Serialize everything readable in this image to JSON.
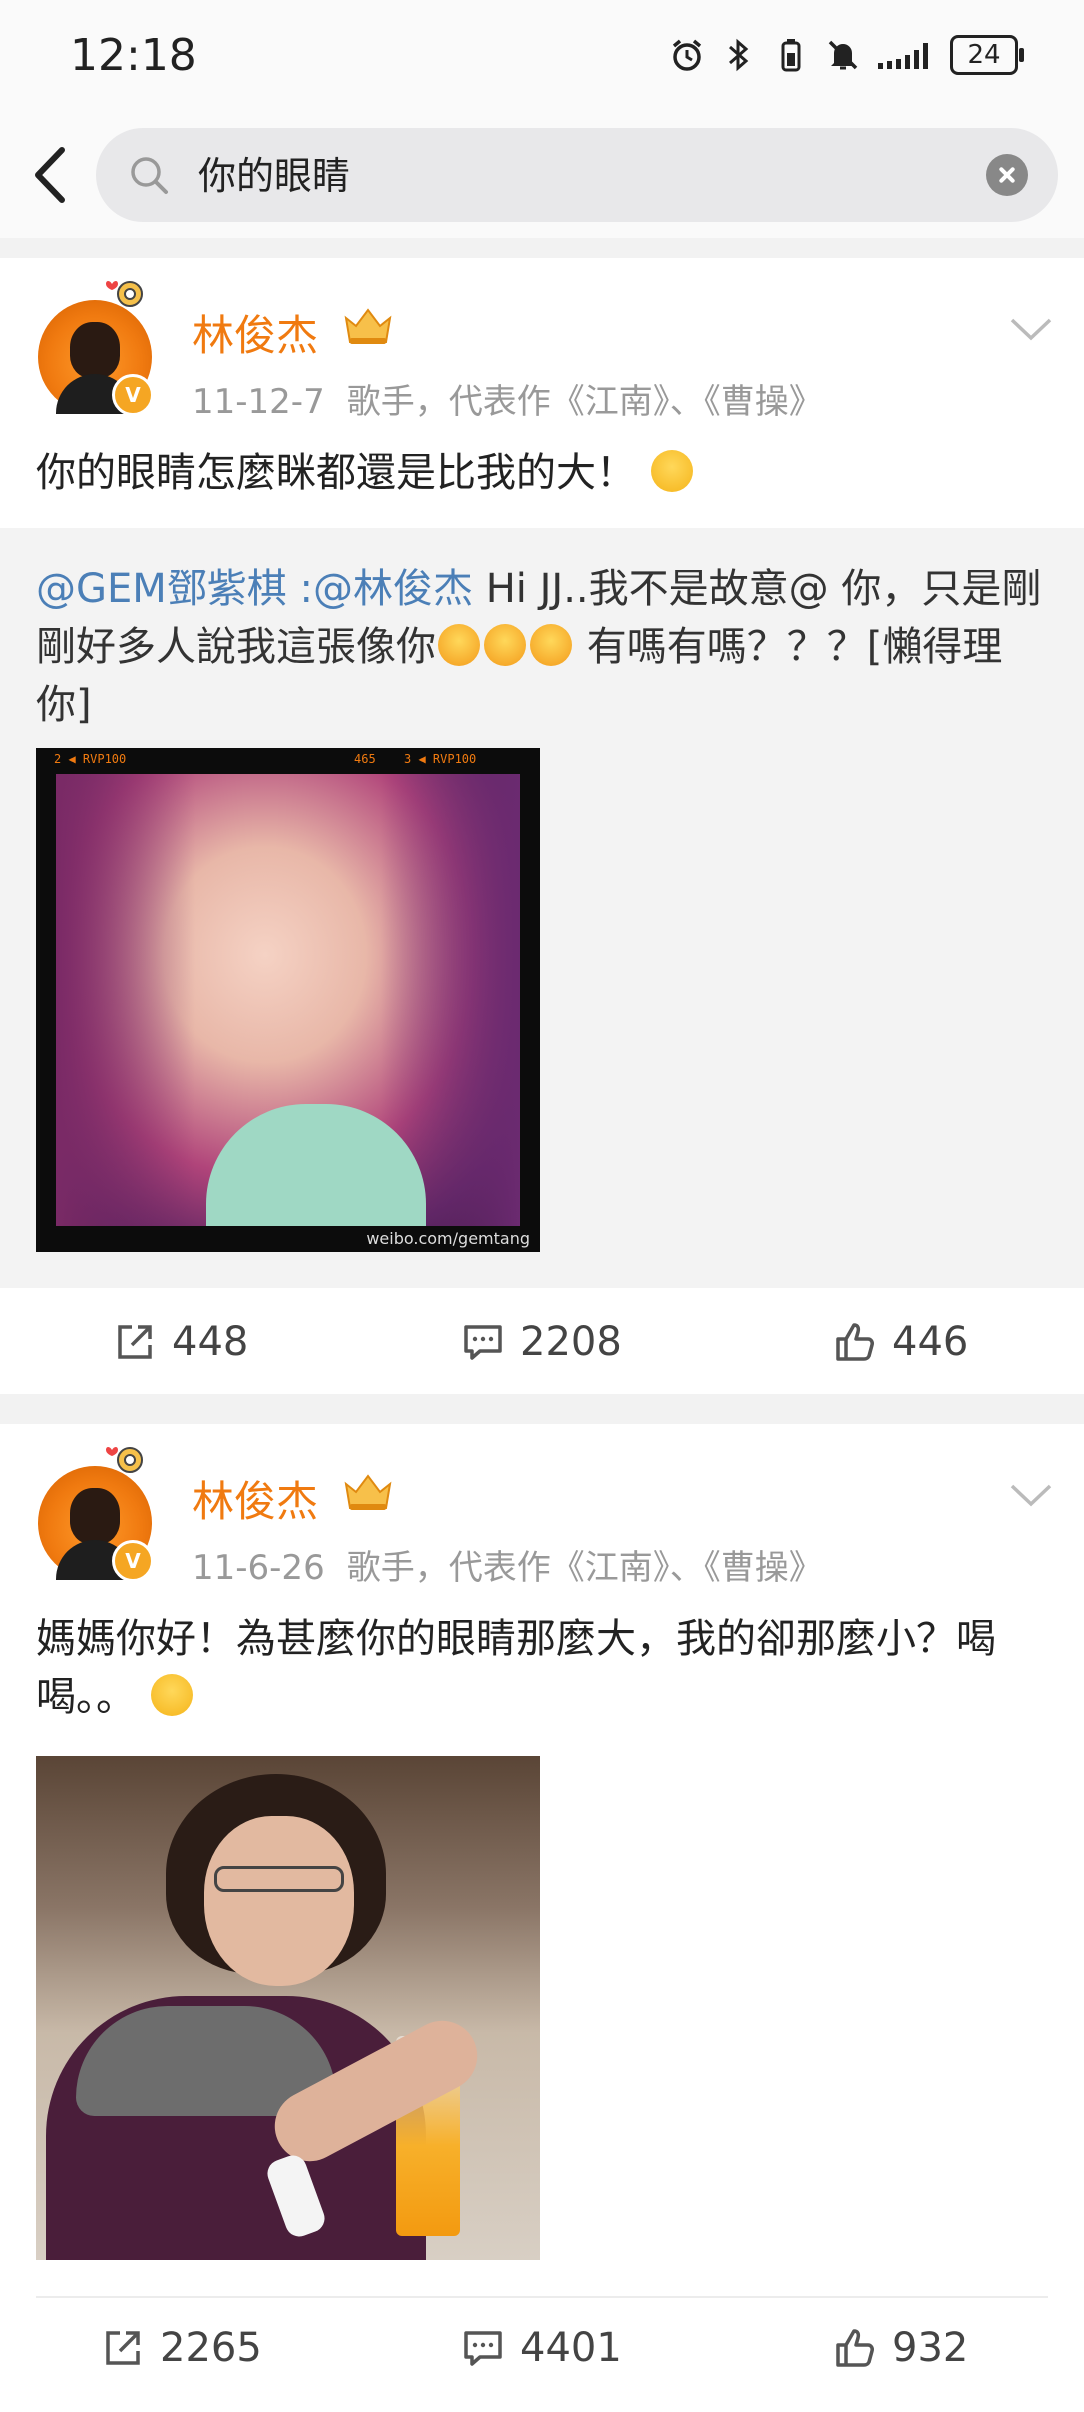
{
  "status_bar": {
    "time": "12:18",
    "battery": "24",
    "icons": [
      "alarm-icon",
      "bluetooth-icon",
      "battery-saver-icon",
      "mute-icon",
      "signal-icon",
      "battery-icon"
    ]
  },
  "search": {
    "query": "你的眼睛",
    "icons": [
      "back-arrow-icon",
      "search-icon",
      "clear-icon"
    ]
  },
  "posts": [
    {
      "author": "林俊杰",
      "date": "11-12-7",
      "bio": "歌手，代表作《江南》、《曹操》",
      "text": "你的眼睛怎麼眯都還是比我的大！",
      "text_emoji": "grin-emoji",
      "repost": {
        "mention1": "@GEM鄧紫棋",
        "sep": " :",
        "mention2": "@林俊杰",
        "text_a": " Hi JJ..我不是故意@ 你，只是剛剛好多人說我這張像你",
        "text_b": " 有嗎有嗎？？？[懶得理你]",
        "emojis": [
          "laugh-emoji",
          "laugh-emoji",
          "laugh-emoji"
        ],
        "photo_bar_left": "2 ◀ RVP100",
        "photo_bar_mid": "465",
        "photo_bar_right": "3 ◀ RVP100",
        "photo_watermark": "weibo.com/gemtang"
      },
      "actions": {
        "reposts": "448",
        "comments": "2208",
        "likes": "446"
      }
    },
    {
      "author": "林俊杰",
      "date": "11-6-26",
      "bio": "歌手，代表作《江南》、《曹操》",
      "text": "媽媽你好！為甚麼你的眼睛那麼大，我的卻那麼小？喝喝。。",
      "text_emoji": "sweat-emoji",
      "actions": {
        "reposts": "2265",
        "comments": "4401",
        "likes": "932"
      }
    }
  ],
  "colors": {
    "accent": "#f07a10",
    "mention": "#4b7fb7",
    "meta": "#999999",
    "page_bg": "#f2f2f2"
  }
}
